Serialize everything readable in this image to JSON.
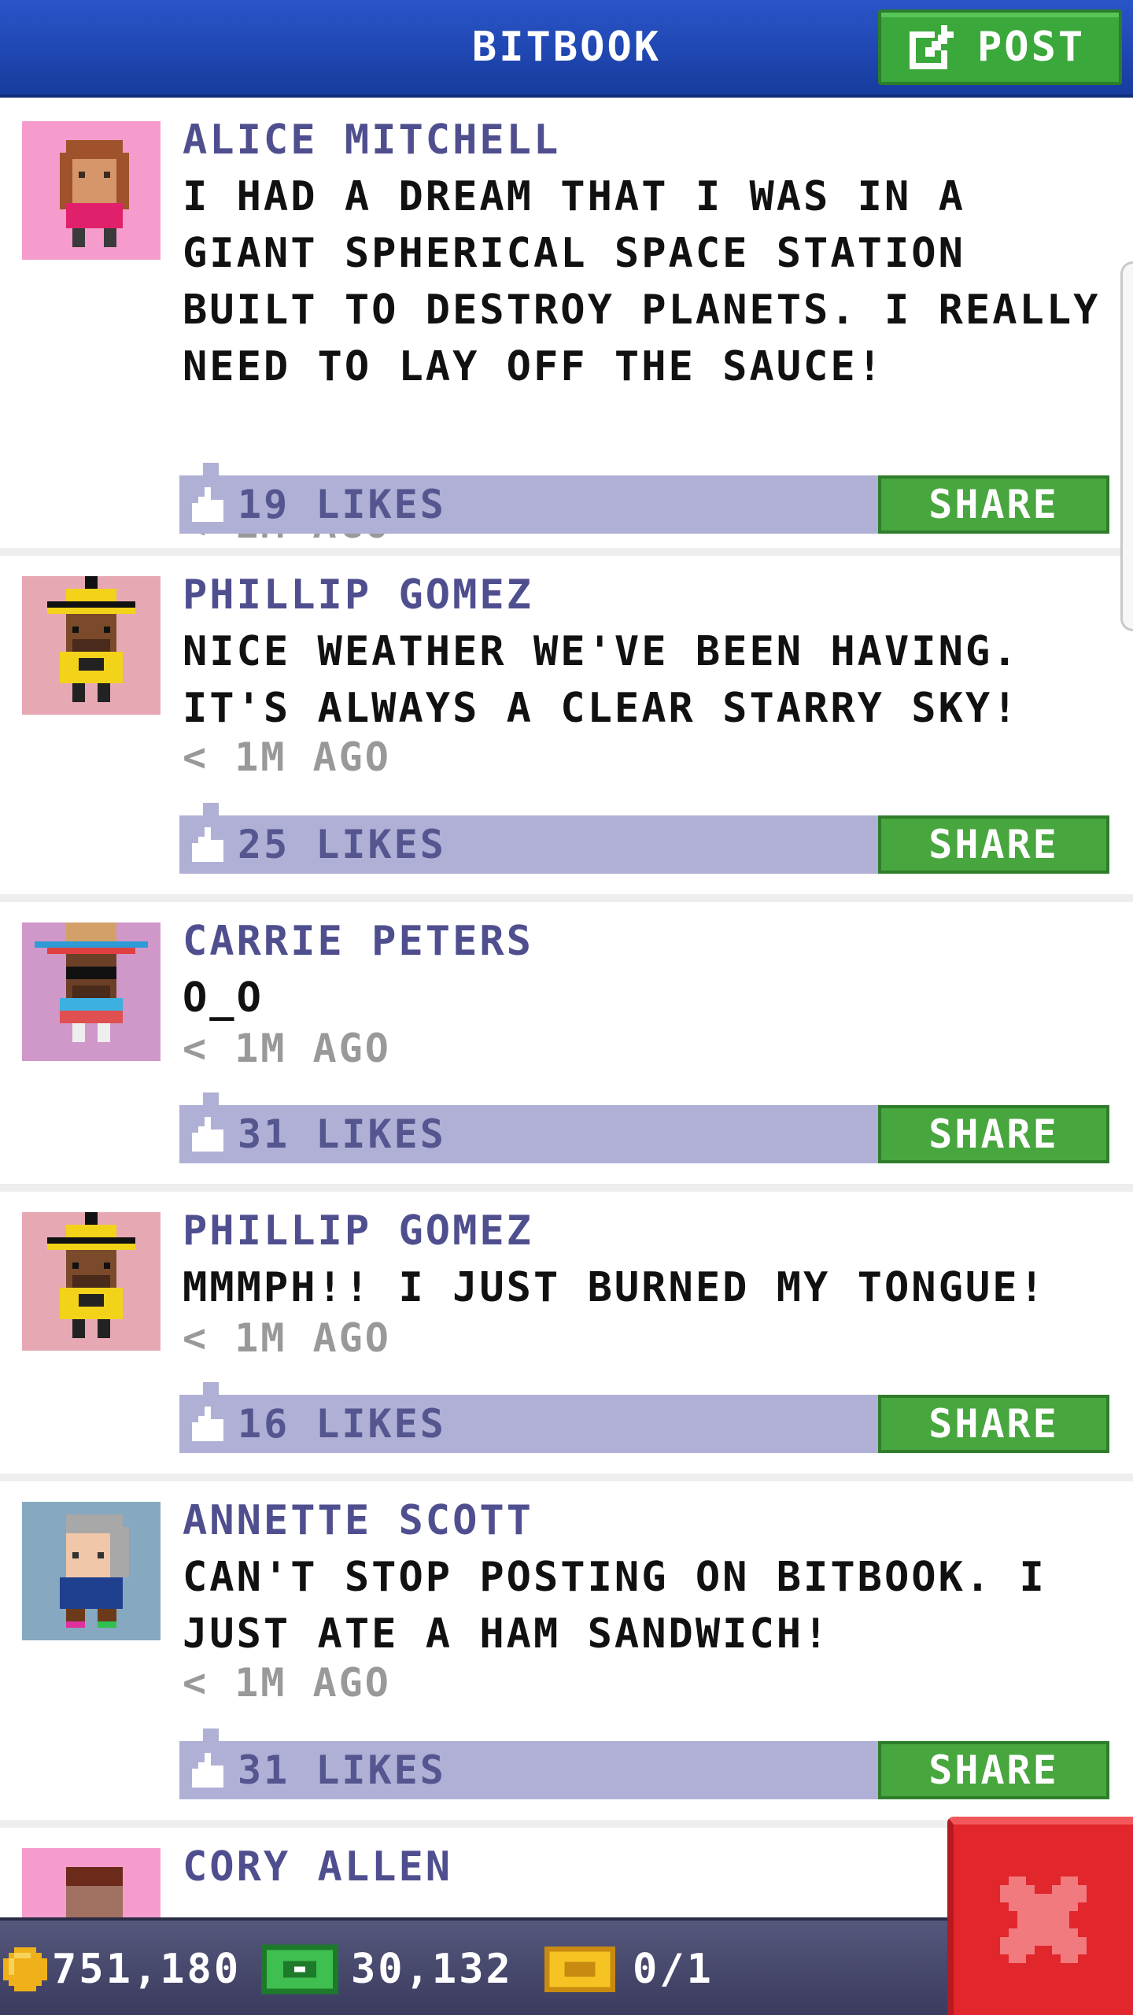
{
  "header": {
    "title": "BITBOOK",
    "post_label": "POST"
  },
  "posts": [
    {
      "author": "ALICE MITCHELL",
      "text": "I HAD A DREAM THAT I WAS IN A GIANT SPHERICAL SPACE STATION BUILT TO DESTROY PLANETS. I REALLY NEED TO LAY OFF THE SAUCE!",
      "time": "< 1M AGO",
      "likes": "19 LIKES",
      "share": "SHARE"
    },
    {
      "author": "PHILLIP GOMEZ",
      "text": "NICE WEATHER WE'VE BEEN HAVING. IT'S ALWAYS A CLEAR STARRY SKY!",
      "time": "< 1M AGO",
      "likes": "25 LIKES",
      "share": "SHARE"
    },
    {
      "author": "CARRIE PETERS",
      "text": "O_O",
      "time": "< 1M AGO",
      "likes": "31 LIKES",
      "share": "SHARE"
    },
    {
      "author": "PHILLIP GOMEZ",
      "text": "MMMPH!! I JUST BURNED MY TONGUE!",
      "time": "< 1M AGO",
      "likes": "16 LIKES",
      "share": "SHARE"
    },
    {
      "author": "ANNETTE SCOTT",
      "text": "CAN'T STOP POSTING ON BITBOOK. I JUST ATE A HAM SANDWICH!",
      "time": "< 1M AGO",
      "likes": "31 LIKES",
      "share": "SHARE"
    },
    {
      "author": "CORY ALLEN"
    }
  ],
  "status": {
    "coins": "751,180",
    "bux": "30,132",
    "tickets": "0/1"
  },
  "colors": {
    "header": "#1f48b5",
    "post_button": "#3aa83a",
    "share_button": "#48a63e",
    "like_bar": "#b0b0d6",
    "author_text": "#4f4f8f",
    "close_button": "#e1262c"
  },
  "icons": [
    "edit-icon",
    "thumbs-up-icon",
    "coin-icon",
    "bux-icon",
    "ticket-icon",
    "close-icon"
  ]
}
